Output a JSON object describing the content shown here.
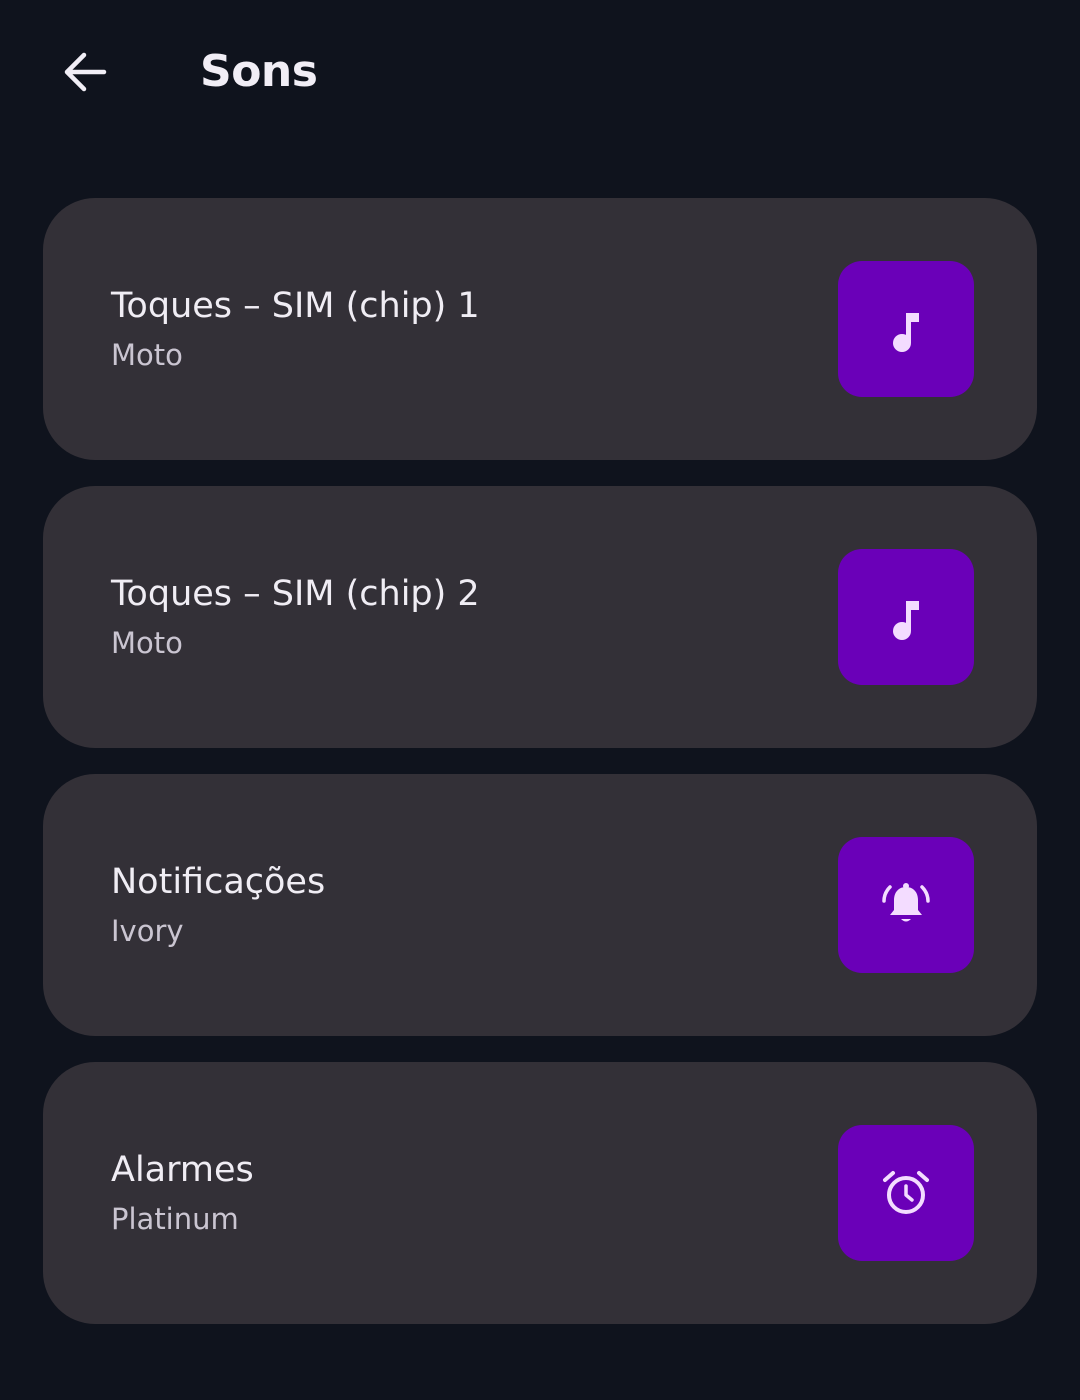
{
  "header": {
    "title": "Sons",
    "back_icon": "arrow-back-icon"
  },
  "colors": {
    "background": "#0f131d",
    "card": "#333037",
    "accent_tile": "#6a00b8",
    "icon": "#f3dcff"
  },
  "items": [
    {
      "title": "Toques – SIM (chip) 1",
      "subtitle": "Moto",
      "icon": "music-note-icon"
    },
    {
      "title": "Toques – SIM (chip) 2",
      "subtitle": "Moto",
      "icon": "music-note-icon"
    },
    {
      "title": "Notificações",
      "subtitle": "Ivory",
      "icon": "ringing-bell-icon"
    },
    {
      "title": "Alarmes",
      "subtitle": "Platinum",
      "icon": "alarm-clock-icon"
    }
  ]
}
